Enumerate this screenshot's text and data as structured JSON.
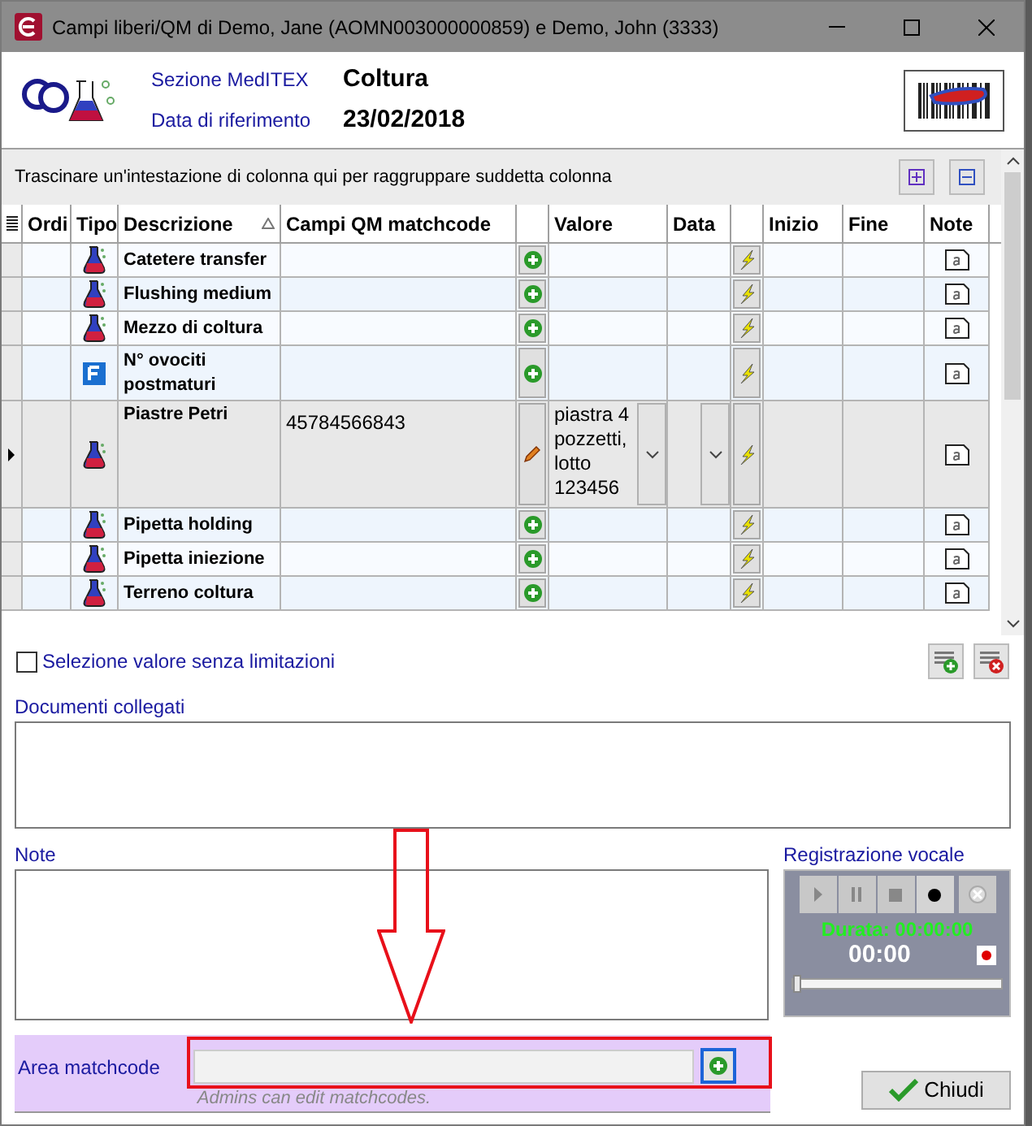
{
  "window": {
    "title": "Campi liberi/QM di Demo, Jane (AOMN003000000859) e Demo, John (3333)"
  },
  "header": {
    "section_label": "Sezione MedITEX",
    "section_value": "Coltura",
    "date_label": "Data di riferimento",
    "date_value": "23/02/2018"
  },
  "grid": {
    "group_hint": "Trascinare un'intestazione di colonna qui per raggruppare suddetta colonna",
    "columns": [
      "Ordi",
      "Tipo",
      "Descrizione",
      "Campi QM matchcode",
      "Valore",
      "Data",
      "Inizio",
      "Fine",
      "Note"
    ],
    "rows": [
      {
        "kind": "flask",
        "description": "Catetere transfer",
        "selected": false
      },
      {
        "kind": "flask",
        "description": "Flushing medium",
        "selected": false
      },
      {
        "kind": "flask",
        "description": "Mezzo di coltura",
        "selected": false
      },
      {
        "kind": "formula",
        "description": "N° ovociti postmaturi",
        "selected": false
      },
      {
        "kind": "flask",
        "description": "Piastre Petri",
        "matchcode": "45784566843",
        "value": "piastra 4 pozzetti, lotto 123456",
        "selected": true
      },
      {
        "kind": "flask",
        "description": "Pipetta holding",
        "selected": false
      },
      {
        "kind": "flask",
        "description": "Pipetta iniezione",
        "selected": false
      },
      {
        "kind": "flask",
        "description": "Terreno coltura",
        "selected": false
      }
    ]
  },
  "unlimited_checkbox": {
    "label": "Selezione valore senza limitazioni",
    "checked": false
  },
  "documents": {
    "label": "Documenti collegati"
  },
  "notes": {
    "label": "Note"
  },
  "voice": {
    "title": "Registrazione vocale",
    "duration": "Durata: 00:00:00",
    "time": "00:00",
    "level": 0
  },
  "matchcode": {
    "label": "Area matchcode",
    "hint": "Admins can edit matchcodes."
  },
  "close_button": {
    "label": "Chiudi"
  }
}
